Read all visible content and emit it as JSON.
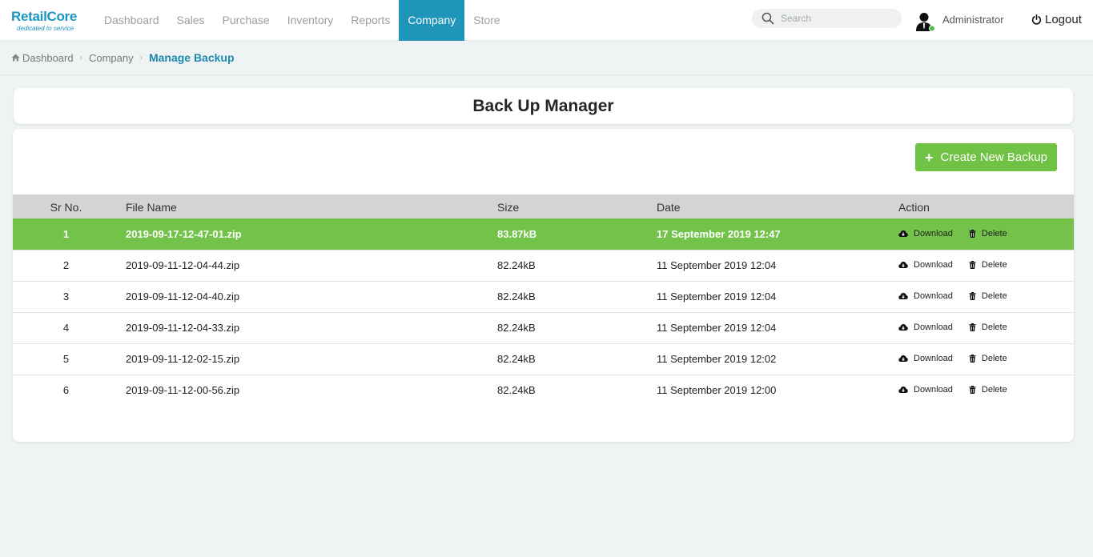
{
  "header": {
    "logo_main": "RetailCore",
    "logo_tagline": "dedicated to service",
    "nav": [
      {
        "label": "Dashboard",
        "active": false
      },
      {
        "label": "Sales",
        "active": false
      },
      {
        "label": "Purchase",
        "active": false
      },
      {
        "label": "Inventory",
        "active": false
      },
      {
        "label": "Reports",
        "active": false
      },
      {
        "label": "Company",
        "active": true
      },
      {
        "label": "Store",
        "active": false
      }
    ],
    "search_placeholder": "Search",
    "user_name": "Administrator",
    "logout_label": "Logout"
  },
  "breadcrumb": {
    "home": "Dashboard",
    "parent": "Company",
    "current": "Manage Backup"
  },
  "page": {
    "title": "Back Up Manager",
    "create_button": "Create New Backup"
  },
  "table": {
    "columns": [
      "Sr No.",
      "File Name",
      "Size",
      "Date",
      "Action"
    ],
    "download_label": "Download",
    "delete_label": "Delete",
    "rows": [
      {
        "sr": "1",
        "file": "2019-09-17-12-47-01.zip",
        "size": "83.87kB",
        "date": "17 September 2019 12:47",
        "highlight": true
      },
      {
        "sr": "2",
        "file": "2019-09-11-12-04-44.zip",
        "size": "82.24kB",
        "date": "11 September 2019 12:04",
        "highlight": false
      },
      {
        "sr": "3",
        "file": "2019-09-11-12-04-40.zip",
        "size": "82.24kB",
        "date": "11 September 2019 12:04",
        "highlight": false
      },
      {
        "sr": "4",
        "file": "2019-09-11-12-04-33.zip",
        "size": "82.24kB",
        "date": "11 September 2019 12:04",
        "highlight": false
      },
      {
        "sr": "5",
        "file": "2019-09-11-12-02-15.zip",
        "size": "82.24kB",
        "date": "11 September 2019 12:02",
        "highlight": false
      },
      {
        "sr": "6",
        "file": "2019-09-11-12-00-56.zip",
        "size": "82.24kB",
        "date": "11 September 2019 12:00",
        "highlight": false
      }
    ]
  },
  "colors": {
    "brand": "#1b95c2",
    "nav_active": "#1f95b9",
    "success": "#70c244",
    "highlight_row": "#73c34a"
  }
}
